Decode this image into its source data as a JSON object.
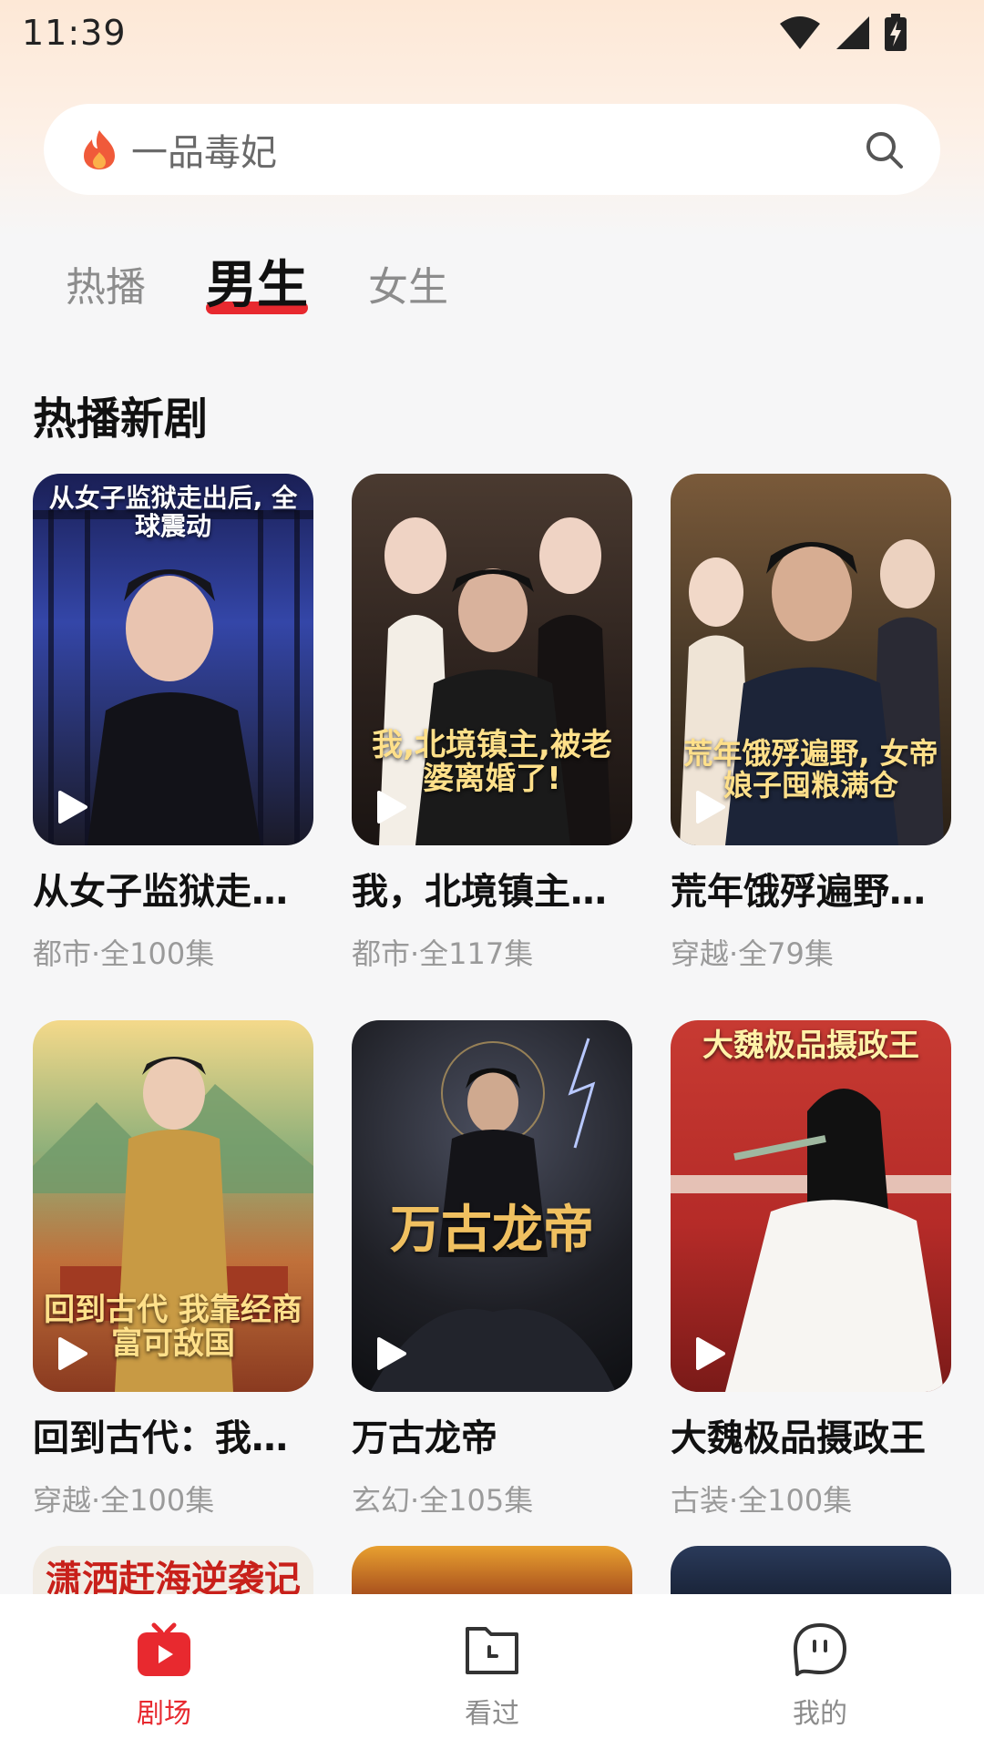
{
  "status_bar": {
    "time": "11:39"
  },
  "search": {
    "placeholder": "一品毒妃"
  },
  "tabs": [
    {
      "label": "热播",
      "active": false
    },
    {
      "label": "男生",
      "active": true
    },
    {
      "label": "女生",
      "active": false
    }
  ],
  "section": {
    "title": "热播新剧",
    "items": [
      {
        "title": "从女子监狱走…",
        "meta": "都市·全100集",
        "cover_text": "从女子监狱走出后, 全球震动",
        "accent": "#2b3a8f"
      },
      {
        "title": "我，北境镇主…",
        "meta": "都市·全117集",
        "cover_text": "我,北境镇主,被老婆离婚了!",
        "accent": "#3a2a22"
      },
      {
        "title": "荒年饿殍遍野…",
        "meta": "穿越·全79集",
        "cover_text": "荒年饿殍遍野, 女帝娘子囤粮满仓",
        "accent": "#5a4630"
      },
      {
        "title": "回到古代：我…",
        "meta": "穿越·全100集",
        "cover_text": "回到古代 我靠经商富可敌国",
        "accent": "#b68a2e"
      },
      {
        "title": "万古龙帝",
        "meta": "玄幻·全105集",
        "cover_text": "万古龙帝",
        "accent": "#1e1f25"
      },
      {
        "title": "大魏极品摄政王",
        "meta": "古装·全100集",
        "cover_text": "大魏极品摄政王",
        "accent": "#b52b28"
      }
    ],
    "partial_items": [
      {
        "cover_text": "潇洒赶海逆袭记"
      }
    ]
  },
  "nav": [
    {
      "label": "剧场",
      "icon": "theater-icon",
      "active": true
    },
    {
      "label": "看过",
      "icon": "history-folder-icon",
      "active": false
    },
    {
      "label": "我的",
      "icon": "profile-icon",
      "active": false
    }
  ],
  "colors": {
    "accent": "#e8292f"
  }
}
